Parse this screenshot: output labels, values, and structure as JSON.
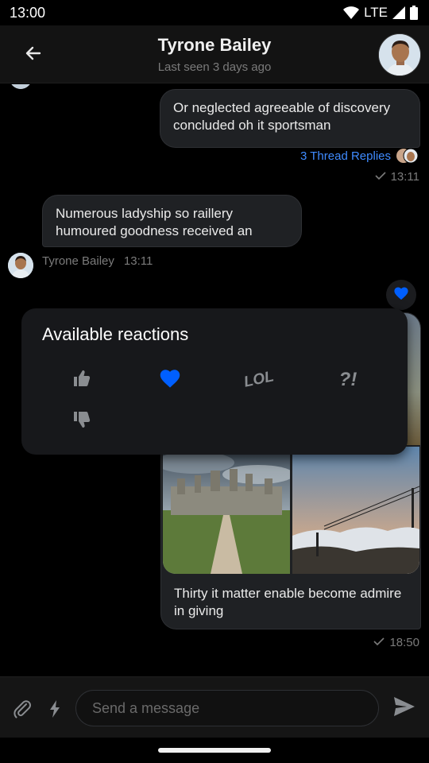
{
  "status_bar": {
    "time": "13:00",
    "network": "LTE"
  },
  "header": {
    "title": "Tyrone Bailey",
    "subtitle": "Last seen 3 days ago"
  },
  "messages": [
    {
      "direction": "outgoing",
      "text": "Or neglected agreeable of discovery concluded oh it sportsman",
      "thread_replies": "3 Thread Replies",
      "time": "13:11",
      "status": "sent"
    },
    {
      "direction": "incoming",
      "text": "Numerous ladyship so raillery humoured goodness received an",
      "sender": "Tyrone Bailey",
      "time": "13:11"
    },
    {
      "direction": "outgoing",
      "type": "image-gallery",
      "own_reaction": "heart",
      "caption": "Thirty it matter enable become admire in giving",
      "time": "18:50",
      "status": "sent"
    }
  ],
  "reactions_popup": {
    "title": "Available reactions",
    "items": [
      {
        "name": "like",
        "icon": "thumbs-up-icon",
        "selected": false
      },
      {
        "name": "love",
        "icon": "heart-icon",
        "selected": true
      },
      {
        "name": "lol",
        "icon": "lol-icon",
        "label": "LOL",
        "selected": false
      },
      {
        "name": "wow",
        "icon": "interrobang-icon",
        "label": "?!",
        "selected": false
      },
      {
        "name": "sad",
        "icon": "thumbs-down-icon",
        "selected": false
      }
    ]
  },
  "composer": {
    "placeholder": "Send a message"
  },
  "colors": {
    "accent": "#005fff",
    "link": "#3f8bff",
    "bubble": "#1f2124",
    "background": "#000000"
  }
}
